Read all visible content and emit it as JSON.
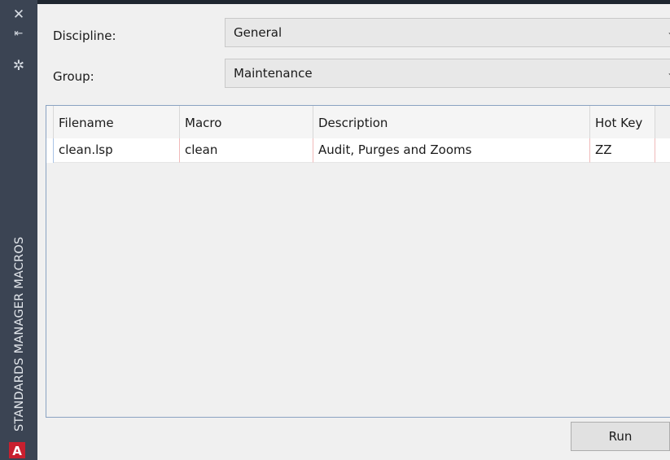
{
  "panel": {
    "vertical_title": "STANDARDS MANAGER MACROS",
    "close_glyph": "✕",
    "pin_glyph": "⇤",
    "settings_glyph": "✲",
    "logo_letter": "A"
  },
  "form": {
    "discipline_label": "Discipline:",
    "discipline_value": "General",
    "group_label": "Group:",
    "group_value": "Maintenance",
    "chevron": "⌄"
  },
  "table": {
    "columns": [
      "Filename",
      "Macro",
      "Description",
      "Hot Key"
    ],
    "rows": [
      [
        "clean.lsp",
        "clean",
        "Audit, Purges and Zooms",
        "ZZ"
      ]
    ]
  },
  "actions": {
    "run_label": "Run"
  }
}
